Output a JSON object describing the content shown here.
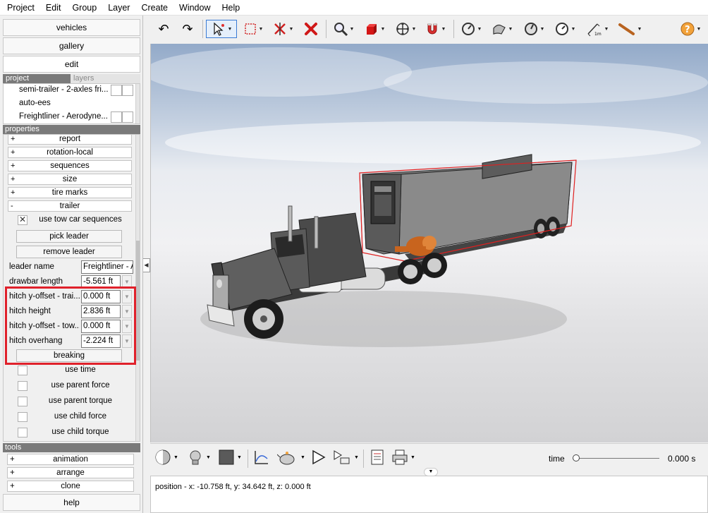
{
  "menu": [
    "Project",
    "Edit",
    "Group",
    "Layer",
    "Create",
    "Window",
    "Help"
  ],
  "nav_buttons": {
    "vehicles": "vehicles",
    "gallery": "gallery",
    "edit": "edit"
  },
  "project_tabs": {
    "project": "project",
    "layers": "layers"
  },
  "project_items": [
    "semi-trailer - 2-axles fri...",
    "auto-ees",
    "Freightliner - Aerodyne..."
  ],
  "properties_header": "properties",
  "property_groups": [
    {
      "toggle": "+",
      "label": "report"
    },
    {
      "toggle": "+",
      "label": "rotation-local"
    },
    {
      "toggle": "+",
      "label": "sequences"
    },
    {
      "toggle": "+",
      "label": "size"
    },
    {
      "toggle": "+",
      "label": "tire marks"
    },
    {
      "toggle": "-",
      "label": "trailer"
    }
  ],
  "trailer": {
    "use_tow_car_sequences": "use tow car sequences",
    "pick_leader": "pick leader",
    "remove_leader": "remove leader",
    "leader_name_label": "leader name",
    "leader_name_value": "Freightliner - A",
    "fields": [
      {
        "label": "drawbar length",
        "value": "-5.561 ft"
      },
      {
        "label": "hitch y-offset - trai...",
        "value": "0.000 ft"
      },
      {
        "label": "hitch height",
        "value": "2.836 ft"
      },
      {
        "label": "hitch y-offset - tow...",
        "value": "0.000 ft"
      },
      {
        "label": "hitch overhang",
        "value": "-2.224 ft"
      }
    ],
    "breaking": "breaking",
    "checks": [
      "use time",
      "use parent force",
      "use parent torque",
      "use child force",
      "use child torque"
    ]
  },
  "tools_header": "tools",
  "tool_groups": [
    {
      "toggle": "+",
      "label": "animation"
    },
    {
      "toggle": "+",
      "label": "arrange"
    },
    {
      "toggle": "+",
      "label": "clone"
    }
  ],
  "help_button": "help",
  "time_label": "time",
  "time_value": "0.000 s",
  "status_text": "position - x: -10.758 ft, y: 34.642 ft, z: 0.000 ft",
  "colors": {
    "highlight": "#e0212b",
    "selection_box": "#e02020",
    "hitch": "#c8641e"
  }
}
